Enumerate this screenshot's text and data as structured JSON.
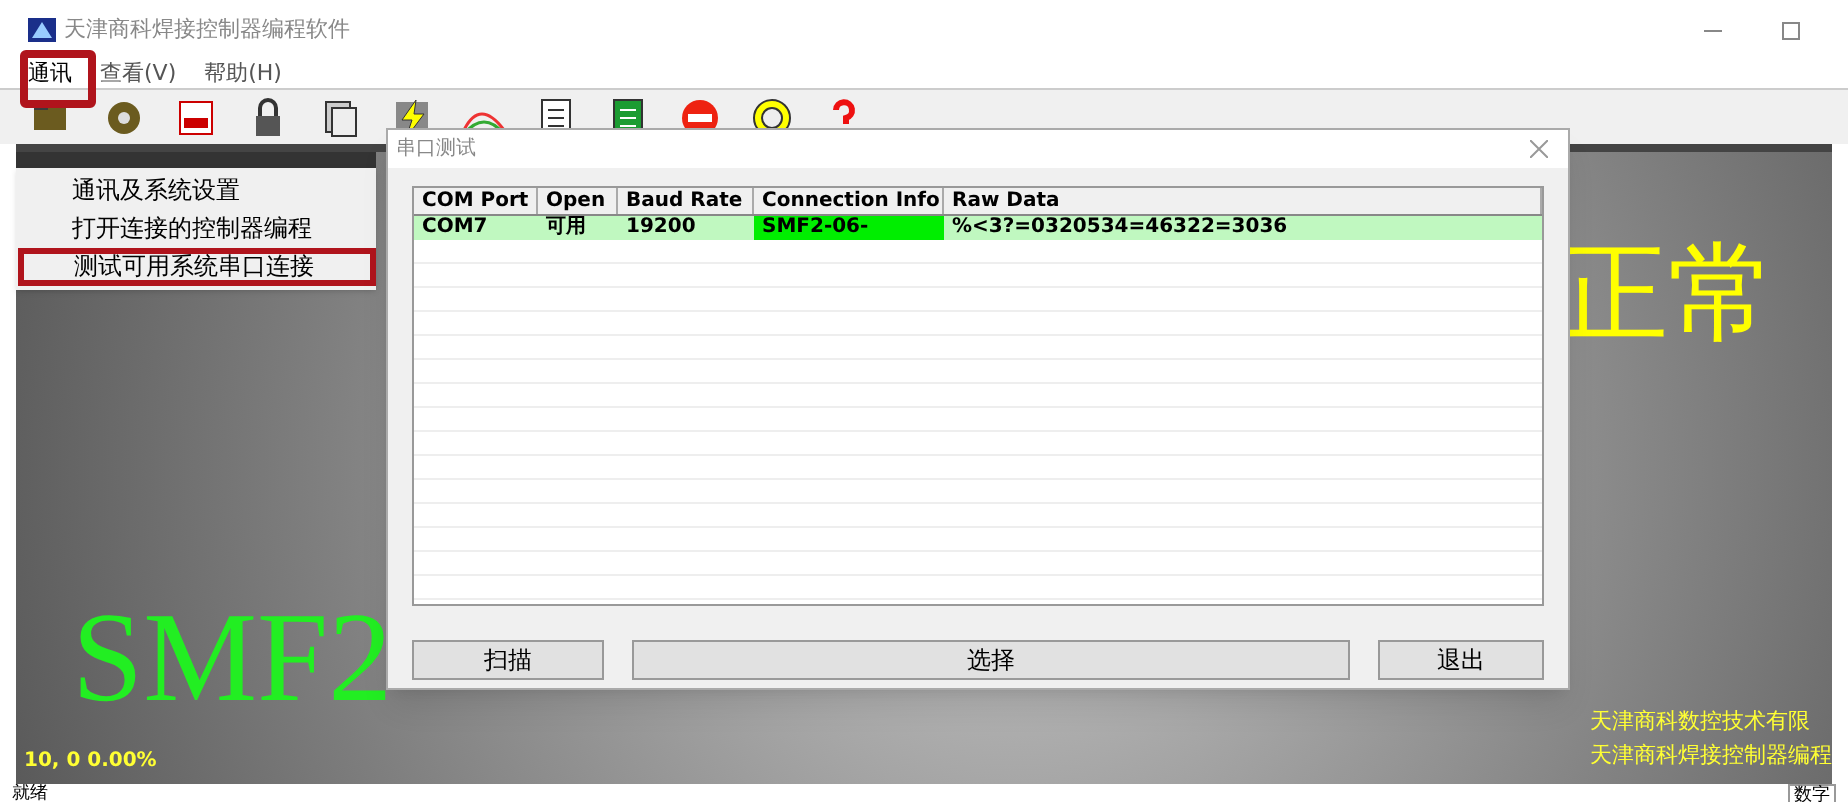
{
  "window": {
    "title": "天津商科焊接控制器编程软件"
  },
  "menu": [
    {
      "label": "通讯",
      "selected": true
    },
    {
      "label": "查看(V)",
      "selected": false
    },
    {
      "label": "帮助(H)",
      "selected": false
    }
  ],
  "dropdown": [
    {
      "label": "通讯及系统设置",
      "highlighted": false
    },
    {
      "label": "打开连接的控制器编程",
      "highlighted": false
    },
    {
      "label": "测试可用系统串口连接",
      "highlighted": true
    }
  ],
  "display": {
    "status_text": "正常",
    "model_text": "SMF2",
    "reading": "10, 0 0.00%",
    "company_lines": [
      "天津商科数控技术有限",
      "天津商科焊接控制器编程"
    ]
  },
  "dialog": {
    "title": "串口测试",
    "columns": [
      "COM Port",
      "Open",
      "Baud Rate",
      "Connection Info",
      "Raw Data"
    ],
    "rows": [
      {
        "cells": [
          "COM7",
          "可用",
          "19200",
          "SMF2-06-",
          "%<3?=0320534=46322=3036"
        ],
        "selected": true
      }
    ],
    "buttons": [
      "扫描",
      "选择",
      "退出"
    ]
  },
  "status_bar": {
    "text": "就绪",
    "indicator": "数字"
  }
}
